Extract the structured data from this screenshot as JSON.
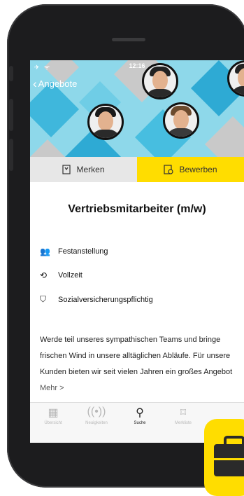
{
  "status": {
    "signal": "✈ ᯤ",
    "time": "12:16"
  },
  "nav": {
    "back_label": "Angebote"
  },
  "actions": {
    "merken_label": "Merken",
    "bewerben_label": "Bewerben"
  },
  "job": {
    "title": "Vertriebsmitarbeiter (m/w)",
    "attributes": [
      {
        "label": "Festanstellung",
        "icon": "people-icon"
      },
      {
        "label": "Vollzeit",
        "icon": "clock-icon"
      },
      {
        "label": "Sozialversicherungspflichtig",
        "icon": "shield-icon"
      }
    ],
    "description_lines": [
      "Werde teil unseres sympathischen Teams und bringe",
      "frischen Wind in unsere alltäglichen Abläufe. Für unsere",
      "Kunden bieten wir seit vielen Jahren ein großes Angebot"
    ],
    "more_label": "Mehr >"
  },
  "tabbar": {
    "items": [
      {
        "label": "Übersicht",
        "icon": "grid-icon",
        "active": false
      },
      {
        "label": "Neuigkeiten",
        "icon": "broadcast-icon",
        "active": false
      },
      {
        "label": "Suche",
        "icon": "search-icon",
        "active": true
      },
      {
        "label": "Merkliste",
        "icon": "bookmark-icon",
        "active": false
      }
    ]
  },
  "colors": {
    "accent_yellow": "#ffdd00",
    "hero_blue": "#8ed8ea",
    "phone_body": "#1c1c1e"
  }
}
